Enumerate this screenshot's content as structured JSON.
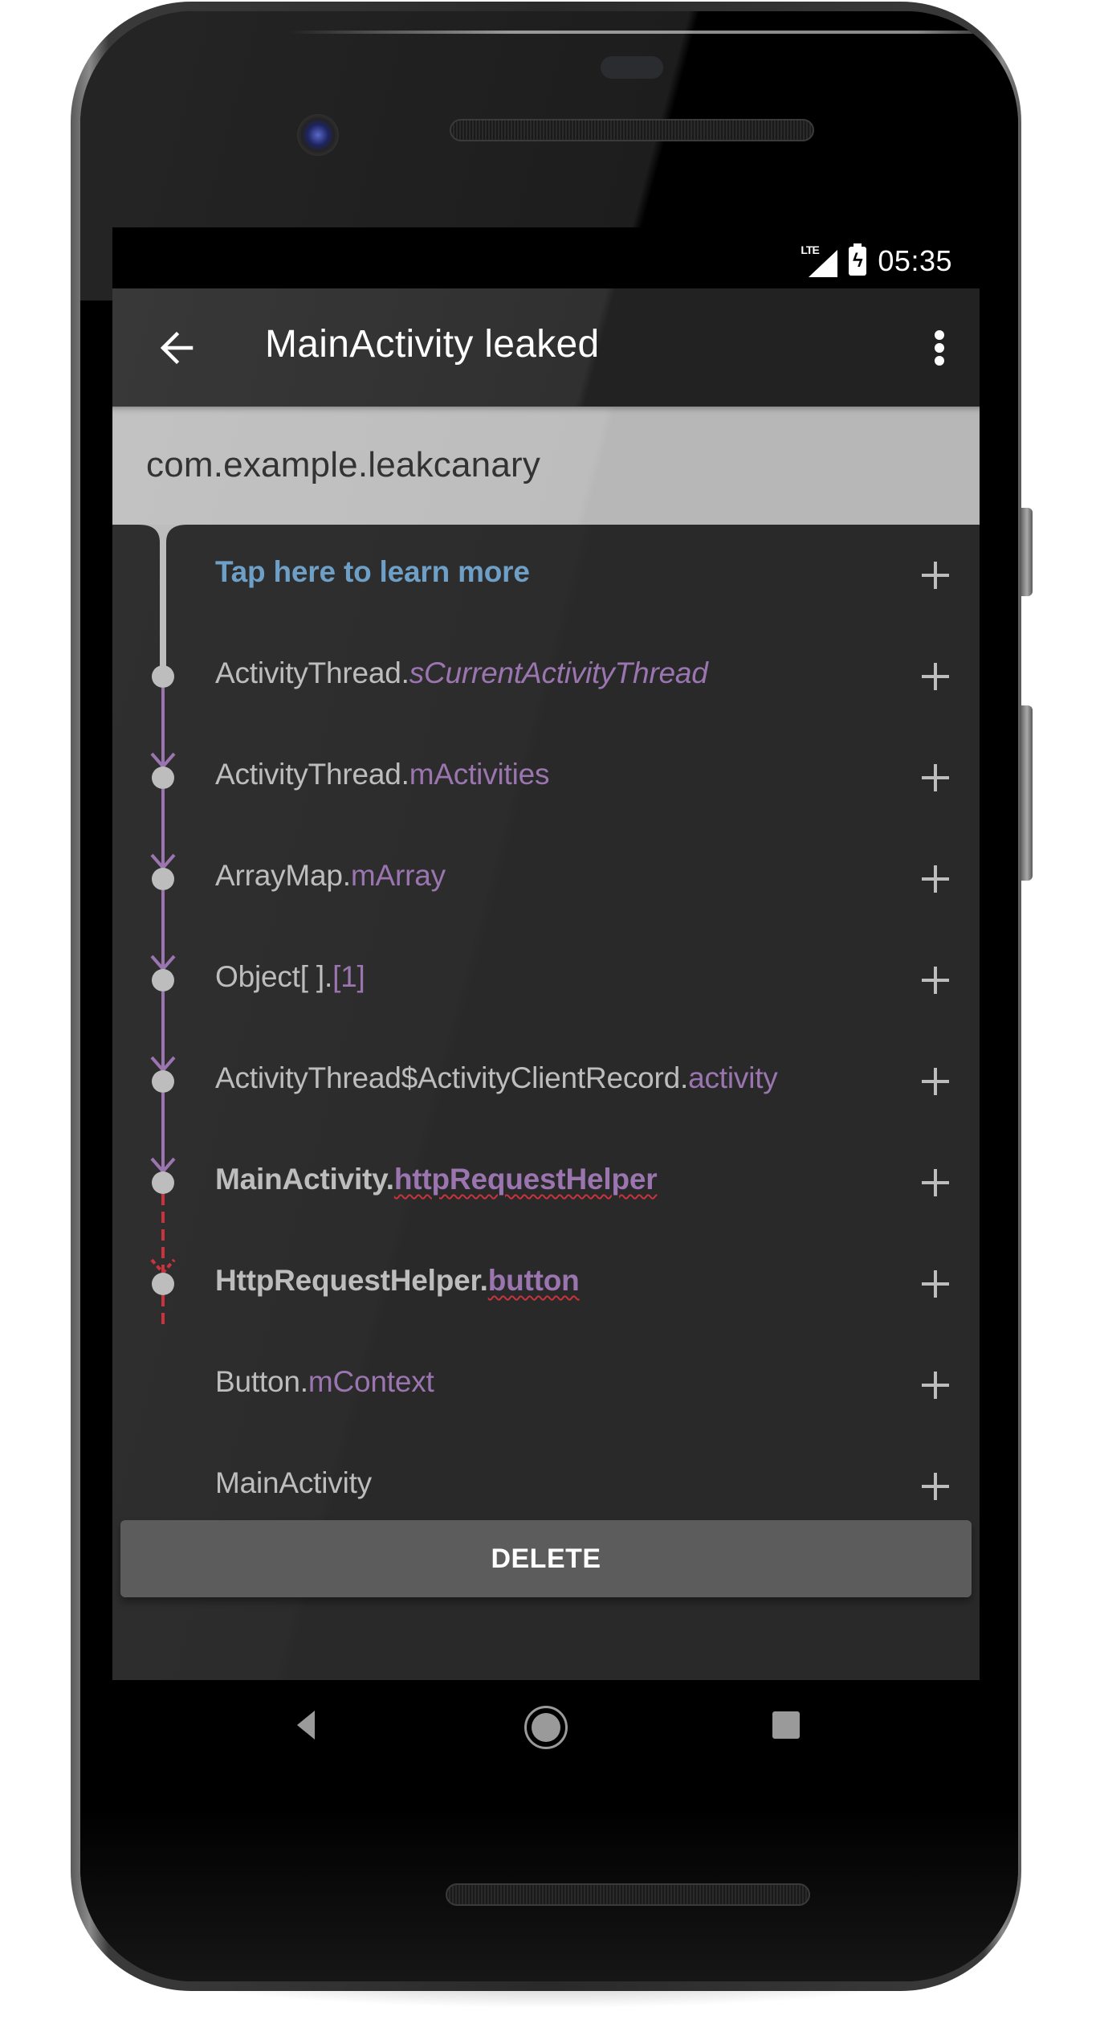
{
  "status_bar": {
    "network": "LTE",
    "time": "05:35",
    "icons": [
      "lte-signal-icon",
      "battery-charging-icon"
    ]
  },
  "app_bar": {
    "title": "MainActivity leaked",
    "back_icon": "arrow-back-icon",
    "menu_icon": "more-vert-icon"
  },
  "header": {
    "package": "com.example.leakcanary"
  },
  "colors": {
    "field": "#9b75b0",
    "learn_link": "#6e9fc6",
    "text": "#bdbdbd",
    "leak_line": "#c8333d",
    "ref_line": "#9b75b0",
    "root_line": "#bdbdbd"
  },
  "trace": {
    "learn_more": "Tap here to learn more",
    "rows": [
      {
        "class": "ActivityThread.",
        "field": "sCurrentActivityThread",
        "italic": true,
        "bold": false,
        "leak": false,
        "edge_in": "root"
      },
      {
        "class": "ActivityThread.",
        "field": "mActivities",
        "italic": false,
        "bold": false,
        "leak": false,
        "edge_in": "reference"
      },
      {
        "class": "ArrayMap.",
        "field": "mArray",
        "italic": false,
        "bold": false,
        "leak": false,
        "edge_in": "reference"
      },
      {
        "class": "Object[ ].",
        "field": "[1]",
        "italic": false,
        "bold": false,
        "leak": false,
        "edge_in": "reference"
      },
      {
        "class": "ActivityThread$ActivityClientRecord.",
        "field": "activity",
        "italic": false,
        "bold": false,
        "leak": false,
        "edge_in": "reference"
      },
      {
        "class": "MainActivity.",
        "field": "httpRequestHelper",
        "italic": false,
        "bold": true,
        "leak": true,
        "edge_in": "reference"
      },
      {
        "class": "HttpRequestHelper.",
        "field": "button",
        "italic": false,
        "bold": true,
        "leak": true,
        "edge_in": "suspect"
      },
      {
        "class": "Button.",
        "field": "mContext",
        "italic": false,
        "bold": false,
        "leak": false,
        "edge_in": "suspect"
      },
      {
        "class": "MainActivity",
        "field": "",
        "italic": false,
        "bold": false,
        "leak": false,
        "edge_in": "reference"
      }
    ],
    "expand_icon": "plus-icon"
  },
  "actions": {
    "delete_label": "DELETE"
  },
  "nav_bar": {
    "back": "nav-back-icon",
    "home": "nav-home-icon",
    "recents": "nav-recents-icon"
  }
}
